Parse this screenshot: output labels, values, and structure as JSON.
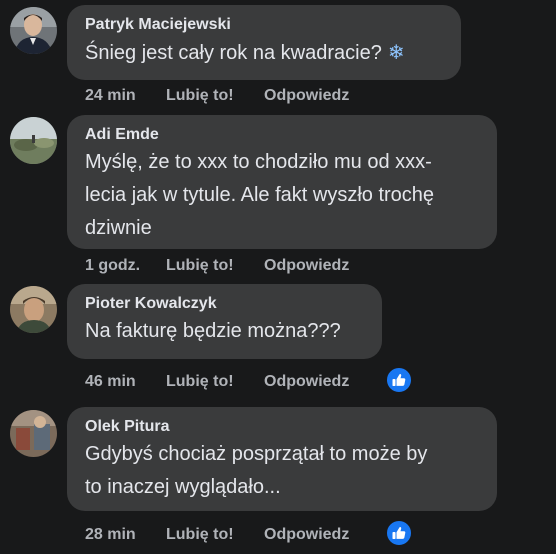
{
  "comments": [
    {
      "author": "Patryk Maciejewski",
      "text": "Śnieg jest cały rok na kwadracie?",
      "emoji": "❄",
      "time": "24 min",
      "like_label": "Lubię to!",
      "reply_label": "Odpowiedz",
      "reaction_icon": "like-icon",
      "has_reaction": false
    },
    {
      "author": "Adi Emde",
      "text_lines": [
        "Myślę, że to xxx to chodziło mu od xxx-",
        "lecia jak w tytule. Ale fakt wyszło trochę",
        "dziwnie"
      ],
      "time": "1 godz.",
      "like_label": "Lubię to!",
      "reply_label": "Odpowiedz",
      "has_reaction": false
    },
    {
      "author": "Pioter Kowalczyk",
      "text": "Na fakturę będzie można???",
      "time": "46 min",
      "like_label": "Lubię to!",
      "reply_label": "Odpowiedz",
      "has_reaction": true,
      "reaction_icon": "thumbs-up-icon"
    },
    {
      "author": "Olek Pitura",
      "text_lines": [
        "Gdybyś chociaż posprzątał to może by",
        "to inaczej wyglądało..."
      ],
      "time": "28 min",
      "like_label": "Lubię to!",
      "reply_label": "Odpowiedz",
      "has_reaction": true,
      "reaction_icon": "thumbs-up-icon"
    }
  ],
  "colors": {
    "background": "#18191a",
    "bubble": "#3a3b3c",
    "text": "#e4e6eb",
    "secondary_text": "#b0b3b8",
    "reaction_blue": "#1877f2"
  }
}
